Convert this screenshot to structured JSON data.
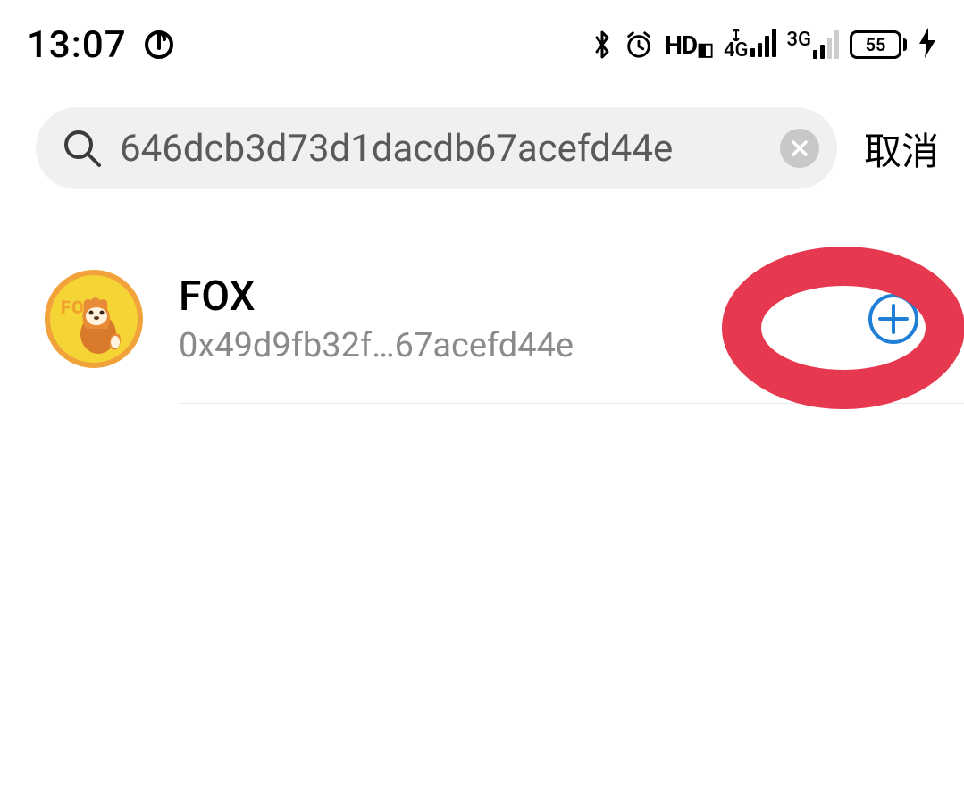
{
  "status": {
    "time": "13:07",
    "hd_label": "HD",
    "signal1_label": "4G",
    "signal2_label": "3G",
    "battery_level": "55"
  },
  "search": {
    "value": "646dcb3d73d1dacdb67acefd44e",
    "cancel_label": "取消"
  },
  "result": {
    "token_name": "FOX",
    "token_address": "0x49d9fb32f…67acefd44e",
    "avatar_label": "FOX"
  }
}
